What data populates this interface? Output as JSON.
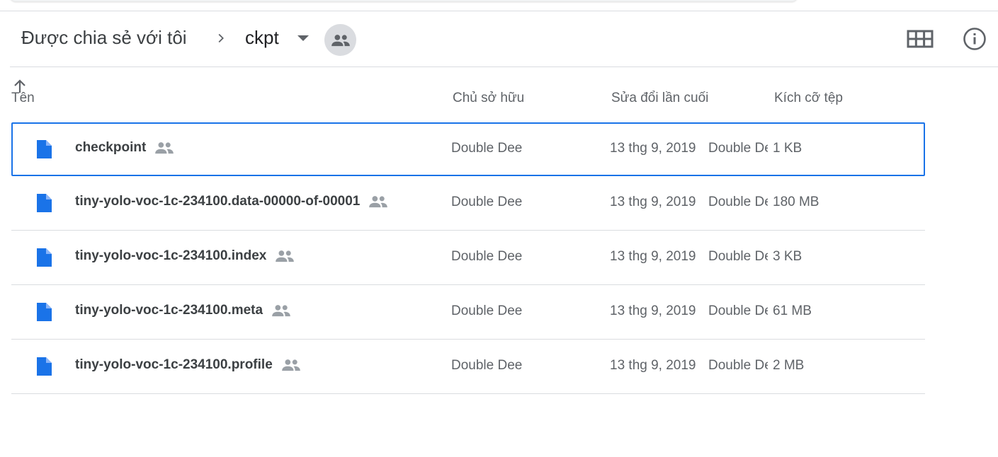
{
  "breadcrumb": {
    "root": "Được chia sẻ với tôi",
    "current": "ckpt"
  },
  "icons": {
    "separator": "chevron-right-icon",
    "dropdown": "arrow-drop-down-icon",
    "shared": "people-icon",
    "grid": "grid-view-icon",
    "info": "info-icon",
    "sort": "arrow-up-icon",
    "file": "document-icon"
  },
  "colors": {
    "accent": "#1a73e8",
    "file_icon": "#1a73e8",
    "divider": "#dadce0"
  },
  "columns": {
    "name": "Tên",
    "owner": "Chủ sở hữu",
    "modified": "Sửa đổi lần cuối",
    "size": "Kích cỡ tệp"
  },
  "files": [
    {
      "name": "checkpoint",
      "owner": "Double Dee",
      "date": "13 thg 9, 2019",
      "modifier": "Double Dee",
      "size": "1 KB"
    },
    {
      "name": "tiny-yolo-voc-1c-234100.data-00000-of-00001",
      "owner": "Double Dee",
      "date": "13 thg 9, 2019",
      "modifier": "Double Dee",
      "size": "180 MB"
    },
    {
      "name": "tiny-yolo-voc-1c-234100.index",
      "owner": "Double Dee",
      "date": "13 thg 9, 2019",
      "modifier": "Double Dee",
      "size": "3 KB"
    },
    {
      "name": "tiny-yolo-voc-1c-234100.meta",
      "owner": "Double Dee",
      "date": "13 thg 9, 2019",
      "modifier": "Double Dee",
      "size": "61 MB"
    },
    {
      "name": "tiny-yolo-voc-1c-234100.profile",
      "owner": "Double Dee",
      "date": "13 thg 9, 2019",
      "modifier": "Double Dee",
      "size": "2 MB"
    }
  ]
}
